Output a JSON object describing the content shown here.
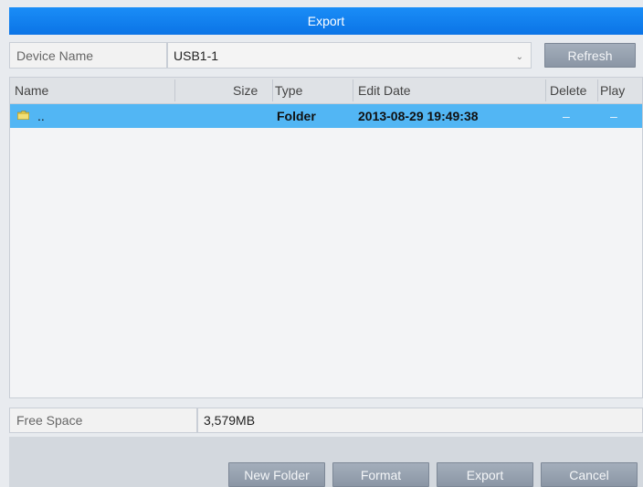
{
  "title": "Export",
  "device": {
    "label": "Device Name",
    "value": "USB1-1",
    "refresh_label": "Refresh"
  },
  "table": {
    "columns": {
      "name": "Name",
      "size": "Size",
      "type": "Type",
      "edit_date": "Edit Date",
      "delete": "Delete",
      "play": "Play"
    },
    "rows": [
      {
        "name": "..",
        "size": "",
        "type": "Folder",
        "edit_date": "2013-08-29 19:49:38",
        "delete": "–",
        "play": "–",
        "icon": "folder-up-icon",
        "selected": true
      }
    ]
  },
  "free_space": {
    "label": "Free Space",
    "value": "3,579MB"
  },
  "buttons": {
    "new_folder": "New Folder",
    "format": "Format",
    "export": "Export",
    "cancel": "Cancel"
  },
  "colors": {
    "title_bar": "#1a8df7",
    "selected_row": "#52b6f4",
    "button": "#9aa5b3"
  }
}
